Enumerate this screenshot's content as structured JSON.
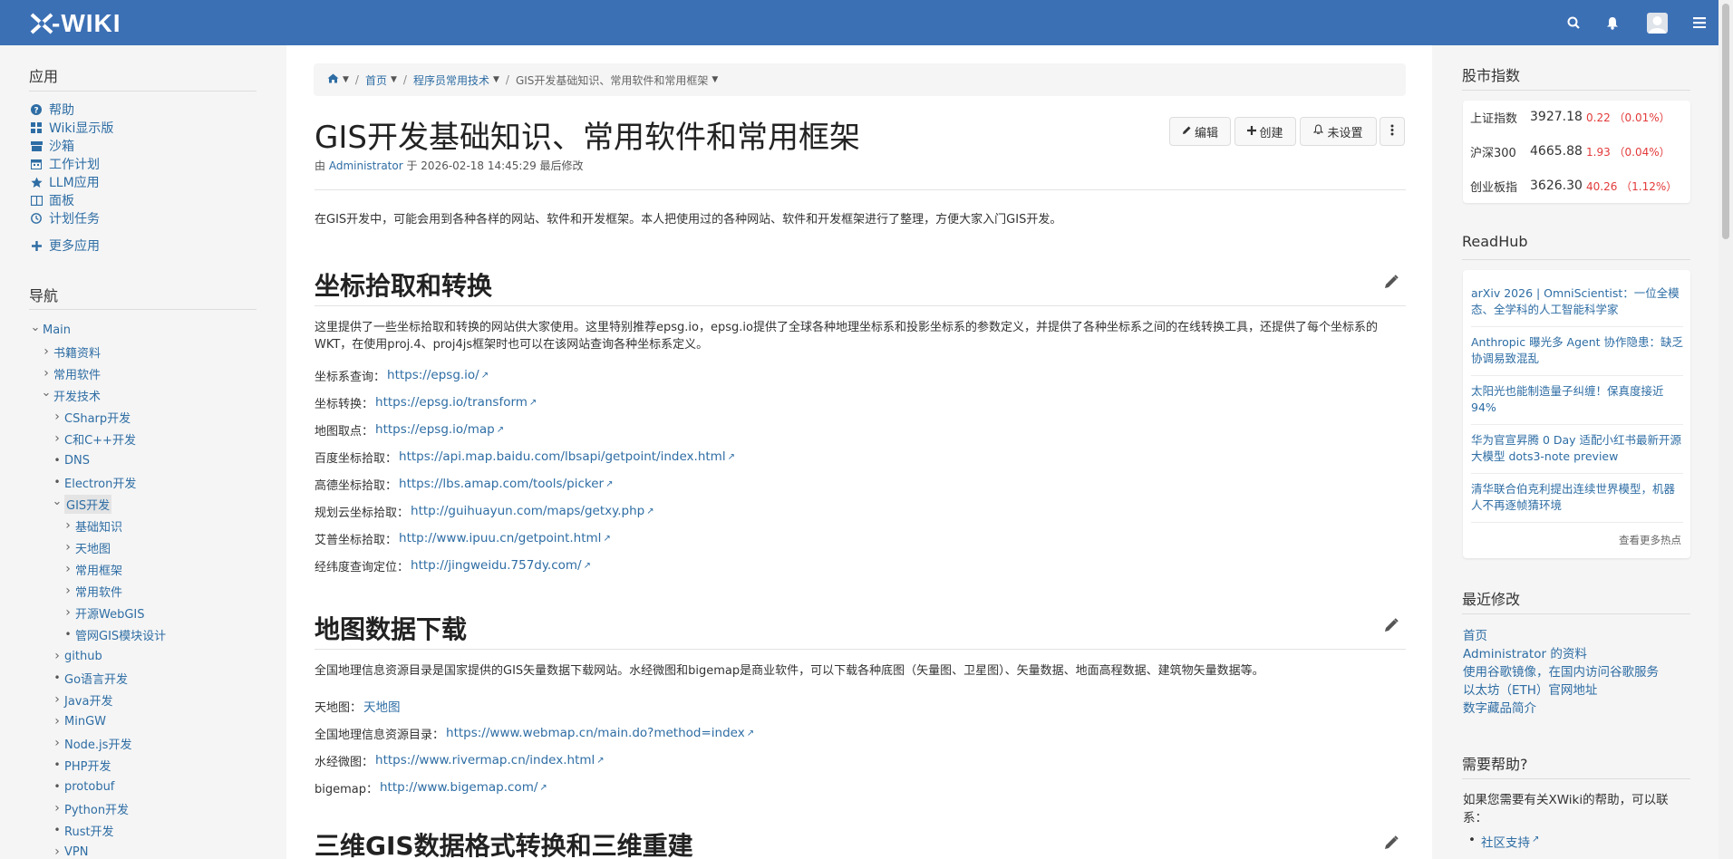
{
  "topbar": {
    "logo": "XWIKI",
    "bg": "#3c70b5"
  },
  "apps": {
    "heading": "应用",
    "items": [
      {
        "label": "帮助",
        "icon": "question-icon"
      },
      {
        "label": "Wiki显示版",
        "icon": "grid-icon"
      },
      {
        "label": "沙箱",
        "icon": "sandbox-icon"
      },
      {
        "label": "工作计划",
        "icon": "calendar-icon"
      },
      {
        "label": "LLM应用",
        "icon": "star-icon"
      },
      {
        "label": "面板",
        "icon": "panel-icon"
      },
      {
        "label": "计划任务",
        "icon": "clock-icon"
      }
    ],
    "more": "更多应用"
  },
  "nav": {
    "heading": "导航",
    "items": [
      {
        "label": "Main",
        "expander": "v"
      },
      {
        "label": "书籍资料",
        "expander": ">"
      },
      {
        "label": "常用软件",
        "expander": ">"
      },
      {
        "label": "开发技术",
        "expander": "v"
      },
      {
        "label": "CSharp开发",
        "expander": ">"
      },
      {
        "label": "C和C++开发",
        "expander": ">"
      },
      {
        "label": "DNS",
        "expander": "•"
      },
      {
        "label": "Electron开发",
        "expander": "•"
      },
      {
        "label": "GIS开发",
        "expander": "v"
      },
      {
        "label": "基础知识",
        "expander": ">"
      },
      {
        "label": "天地图",
        "expander": ">"
      },
      {
        "label": "常用框架",
        "expander": ">"
      },
      {
        "label": "常用软件",
        "expander": ">"
      },
      {
        "label": "开源WebGIS",
        "expander": ">"
      },
      {
        "label": "管网GIS模块设计",
        "expander": "•"
      },
      {
        "label": "github",
        "expander": ">"
      },
      {
        "label": "Go语言开发",
        "expander": "•"
      },
      {
        "label": "Java开发",
        "expander": ">"
      },
      {
        "label": "MinGW",
        "expander": ">"
      },
      {
        "label": "Node.js开发",
        "expander": ">"
      },
      {
        "label": "PHP开发",
        "expander": "•"
      },
      {
        "label": "protobuf",
        "expander": "•"
      },
      {
        "label": "Python开发",
        "expander": ">"
      },
      {
        "label": "Rust开发",
        "expander": "•"
      },
      {
        "label": "VPN",
        "expander": ">"
      }
    ]
  },
  "breadcrumb": [
    "首页",
    "程序员常用技术",
    "GIS开发基础知识、常用软件和常用框架"
  ],
  "page": {
    "title": "GIS开发基础知识、常用软件和常用框架",
    "meta_by": "由",
    "meta_author": "Administrator",
    "meta_rest": "于 2026-02-18 14:45:29 最后修改",
    "buttons": {
      "edit": "编辑",
      "create": "创建",
      "notify": "未设置"
    },
    "intro": "在GIS开发中，可能会用到各种各样的网站、软件和开发框架。本人把使用过的各种网站、软件和开发框架进行了整理，方便大家入门GIS开发。"
  },
  "sections": [
    {
      "title": "坐标拾取和转换",
      "text": "这里提供了一些坐标拾取和转换的网站供大家使用。这里特别推荐epsg.io，epsg.io提供了全球各种地理坐标系和投影坐标系的参数定义，并提供了各种坐标系之间的在线转换工具，还提供了每个坐标系的WKT，在使用proj.4、proj4js框架时也可以在该网站查询各种坐标系定义。",
      "links": [
        {
          "label": "坐标系查询：",
          "url": "https://epsg.io/"
        },
        {
          "label": "坐标转换：",
          "url": "https://epsg.io/transform"
        },
        {
          "label": "地图取点：",
          "url": "https://epsg.io/map"
        },
        {
          "label": "百度坐标拾取：",
          "url": "https://api.map.baidu.com/lbsapi/getpoint/index.html"
        },
        {
          "label": "高德坐标拾取：",
          "url": "https://lbs.amap.com/tools/picker"
        },
        {
          "label": "规划云坐标拾取：",
          "url": "http://guihuayun.com/maps/getxy.php"
        },
        {
          "label": "艾普坐标拾取：",
          "url": "http://www.ipuu.cn/getpoint.html"
        },
        {
          "label": "经纬度查询定位：",
          "url": "http://jingweidu.757dy.com/"
        }
      ]
    },
    {
      "title": "地图数据下载",
      "text": "全国地理信息资源目录是国家提供的GIS矢量数据下载网站。水经微图和bigemap是商业软件，可以下载各种底图（矢量图、卫星图）、矢量数据、地面高程数据、建筑物矢量数据等。",
      "links": [
        {
          "label": "天地图：",
          "url": "天地图"
        },
        {
          "label": "全国地理信息资源目录：",
          "url": "https://www.webmap.cn/main.do?method=index"
        },
        {
          "label": "水经微图：",
          "url": "https://www.rivermap.cn/index.html"
        },
        {
          "label": "bigemap：",
          "url": "http://www.bigemap.com/"
        }
      ]
    },
    {
      "title": "三维GIS数据格式转换和三维重建"
    }
  ],
  "stocks": {
    "heading": "股市指数",
    "rows": [
      {
        "name": "上证指数",
        "value": "3927.18",
        "change": "0.22 （0.01%）"
      },
      {
        "name": "沪深300",
        "value": "4665.88",
        "change": "1.93 （0.04%）"
      },
      {
        "name": "创业板指",
        "value": "3626.30",
        "change": "40.26 （1.12%）"
      }
    ],
    "change_color": "#e33a3a"
  },
  "readhub": {
    "heading": "ReadHub",
    "items": [
      "arXiv 2026 | OmniScientist：一位全模态、全学科的人工智能科学家",
      "Anthropic 曝光多 Agent 协作隐患：缺乏协调易致混乱",
      "太阳光也能制造量子纠缠！保真度接近94%",
      "华为官宣昇腾 0 Day 适配小红书最新开源大模型 dots3-note preview",
      "清华联合伯克利提出连续世界模型，机器人不再逐帧猜环境"
    ],
    "more": "查看更多热点"
  },
  "recent": {
    "heading": "最近修改",
    "items": [
      "首页",
      "Administrator 的资料",
      "使用谷歌镜像，在国内访问谷歌服务",
      "以太坊（ETH）官网地址",
      "数字藏品简介"
    ]
  },
  "help": {
    "heading": "需要帮助?",
    "text": "如果您需要有关XWiki的帮助，可以联系：",
    "items": [
      "社区支持"
    ]
  }
}
